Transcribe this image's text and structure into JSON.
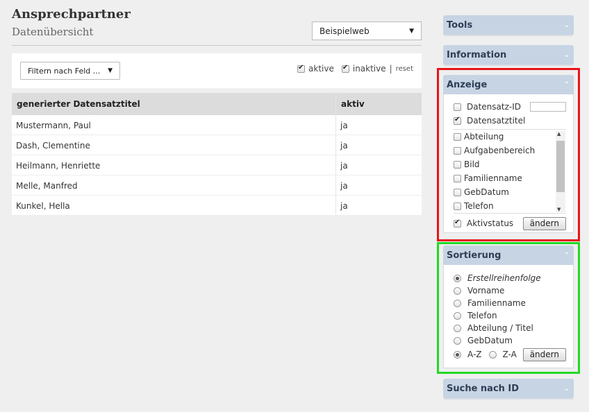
{
  "header": {
    "title": "Ansprechpartner",
    "subtitle": "Datenübersicht",
    "site_select": "Beispielweb"
  },
  "filter": {
    "field_select": "Filtern nach Feld ...",
    "active_label": "aktive",
    "inactive_label": "inaktive",
    "separator": "|",
    "reset_label": "reset"
  },
  "table": {
    "columns": [
      "generierter Datensatztitel",
      "aktiv"
    ],
    "rows": [
      [
        "Mustermann, Paul",
        "ja"
      ],
      [
        "Dash, Clementine",
        "ja"
      ],
      [
        "Heilmann, Henriette",
        "ja"
      ],
      [
        "Melle, Manfred",
        "ja"
      ],
      [
        "Kunkel, Hella",
        "ja"
      ]
    ]
  },
  "sidebar": {
    "tools": "Tools",
    "information": "Information",
    "anzeige": {
      "title": "Anzeige",
      "id_label": "Datensatz-ID",
      "title_label": "Datensatztitel",
      "fields": [
        "Abteilung",
        "Aufgabenbereich",
        "Bild",
        "Familienname",
        "GebDatum",
        "Telefon"
      ],
      "status_label": "Aktivstatus",
      "button": "ändern"
    },
    "sortierung": {
      "title": "Sortierung",
      "options": [
        "Erstellreihenfolge",
        "Vorname",
        "Familienname",
        "Telefon",
        "Abteilung / Titel",
        "GebDatum"
      ],
      "az": "A-Z",
      "za": "Z-A",
      "button": "ändern"
    },
    "suche": "Suche nach ID"
  },
  "colors": {
    "panel_head": "#c6d4e4",
    "red_outline": "#e8141a",
    "green_outline": "#22d926"
  }
}
